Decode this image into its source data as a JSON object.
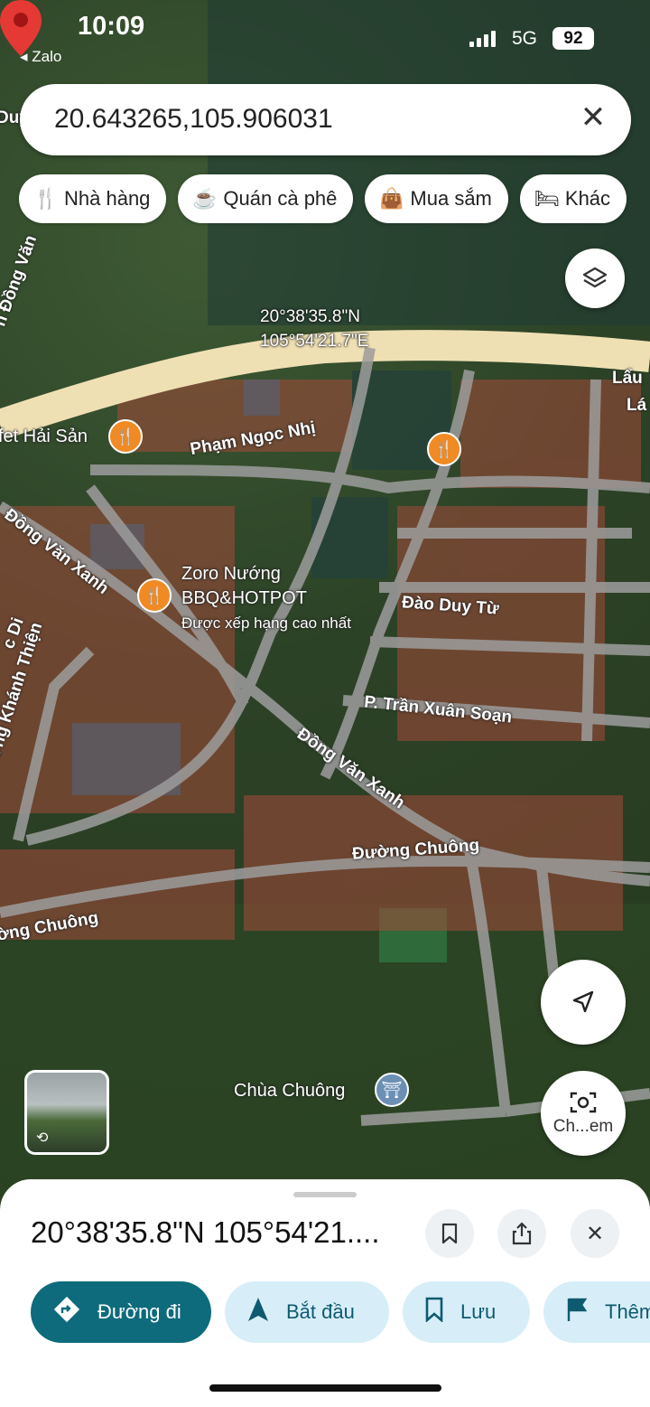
{
  "status_bar": {
    "time": "10:09",
    "back_app": "◂ Zalo",
    "network": "5G",
    "battery": "92"
  },
  "search": {
    "value": "20.643265,105.906031"
  },
  "chips": [
    {
      "label": "Nhà hàng",
      "icon": "fork-knife-icon"
    },
    {
      "label": "Quán cà phê",
      "icon": "coffee-icon"
    },
    {
      "label": "Mua sắm",
      "icon": "shopping-bag-icon"
    },
    {
      "label": "Khác",
      "icon": "bed-icon"
    }
  ],
  "map": {
    "pin": {
      "lat": "20°38'35.8\"N",
      "lng": "105°54'21.7\"E"
    },
    "streets": [
      "Phạm Ngọc Nhị",
      "Đồng Văn Xanh",
      "Đồng Văn Xanh",
      "Đào Duy Từ",
      "P. Trần Xuân Soạn",
      "Đường Chuông",
      "ờng Chuông",
      "ương Khánh Thiện",
      "n Đồng Văn",
      "Lẩu",
      "Lá",
      "c Di",
      "Duy"
    ],
    "pois": [
      {
        "name": "fet Hải Sản"
      },
      {
        "name": "Zoro Nướng",
        "line2": "BBQ&HOTPOT",
        "line3": "Được xếp hạng cao nhất"
      },
      {
        "name": "Chùa Chuông"
      }
    ]
  },
  "buttons": {
    "lens_label": "Ch...em"
  },
  "sheet": {
    "title": "20°38'35.8\"N 105°54'21....",
    "actions": [
      {
        "label": "Đường đi",
        "icon": "directions-icon"
      },
      {
        "label": "Bắt đầu",
        "icon": "navigation-arrow-icon"
      },
      {
        "label": "Lưu",
        "icon": "bookmark-icon"
      },
      {
        "label": "Thêm",
        "icon": "flag-icon"
      }
    ]
  },
  "colors": {
    "primary": "#0d6b7c",
    "chip_bg": "#d7eef8",
    "pin": "#e53935",
    "poi": "#f08a24"
  }
}
